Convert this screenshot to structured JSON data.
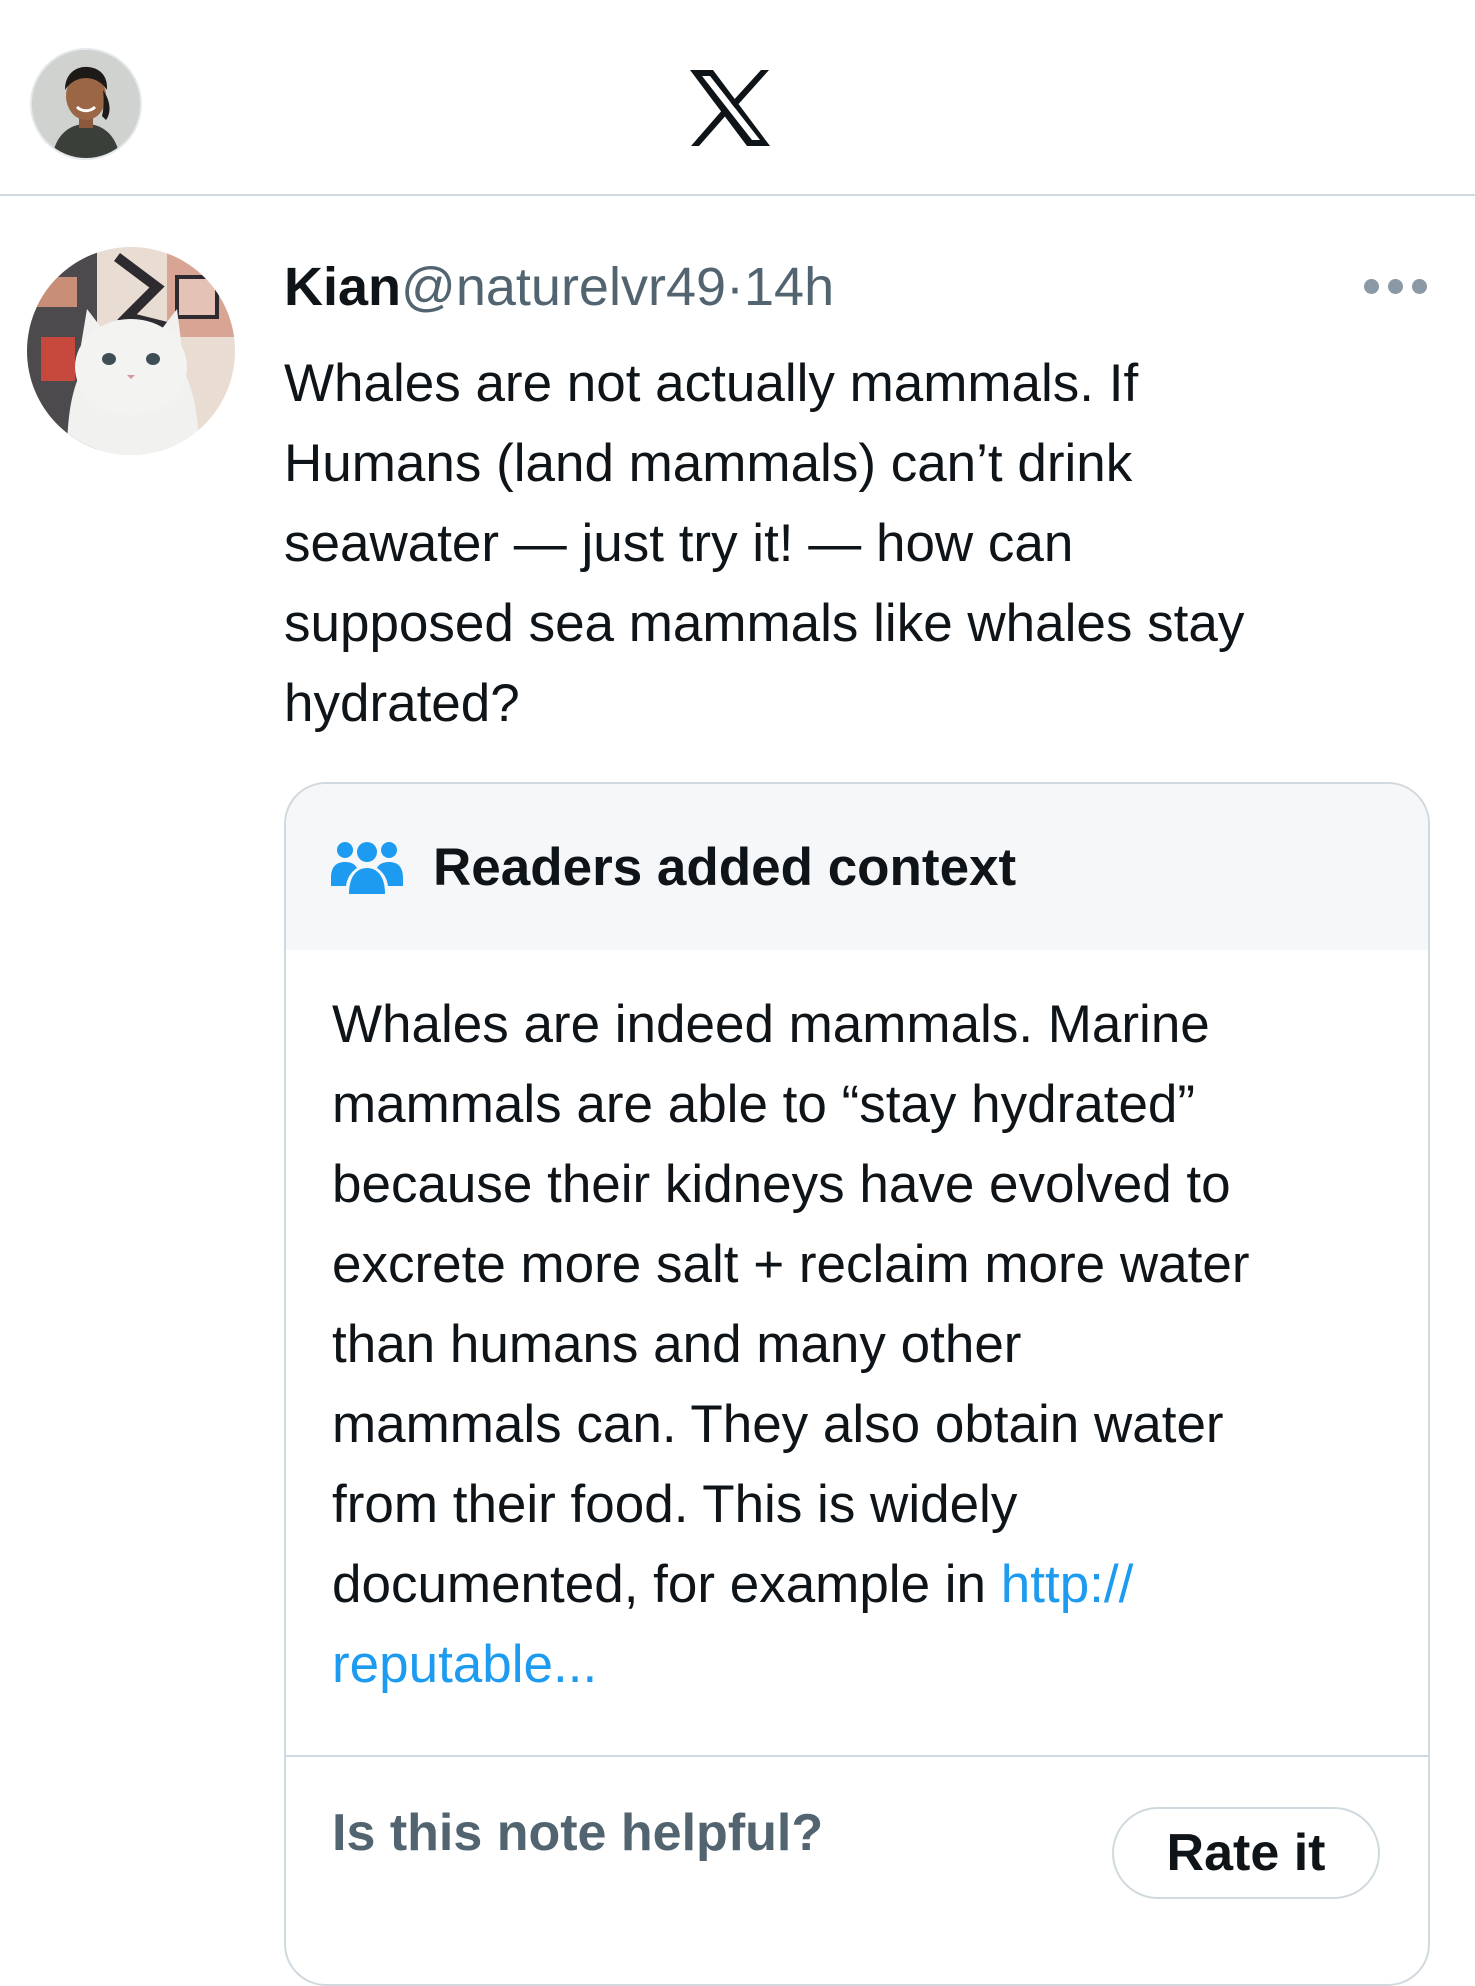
{
  "post": {
    "name": "Kian",
    "handle": "@naturelvr49",
    "separator": "·",
    "time": "14h",
    "text": "Whales are not actually mammals. If\nHumans (land mammals) can’t drink\nseawater — just try it! — how can\nsupposed sea mammals like whales stay\nhydrated?"
  },
  "note": {
    "title": "Readers added context",
    "body": "Whales are indeed mammals. Marine\nmammals are able to “stay hydrated”\nbecause their kidneys have evolved to\nexcrete more salt + reclaim more water\nthan humans and many other\nmammals can. They also obtain water\nfrom their food. This is widely\ndocumented, for example in ",
    "link": "http://\nreputable...",
    "helpful_prompt": "Is this note helpful?",
    "rate_label": "Rate it"
  },
  "icons": {
    "logo": "x-logo",
    "more": "more-icon",
    "note": "people-icon"
  },
  "colors": {
    "link": "#1d9bf0",
    "secondary_text": "#536471",
    "border": "#cfd9de",
    "note_header_bg": "#f6f7f8"
  }
}
